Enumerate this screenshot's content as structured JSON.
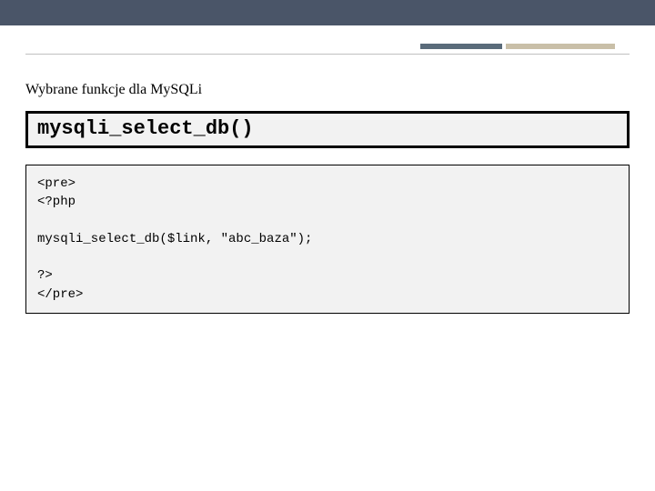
{
  "header": {
    "section_title": "Wybrane funkcje dla MySQLi"
  },
  "function_box": {
    "name": "mysqli_select_db()"
  },
  "code_block": {
    "content": "<pre>\n<?php\n\nmysqli_select_db($link, \"abc_baza\");\n\n?>\n</pre>"
  }
}
